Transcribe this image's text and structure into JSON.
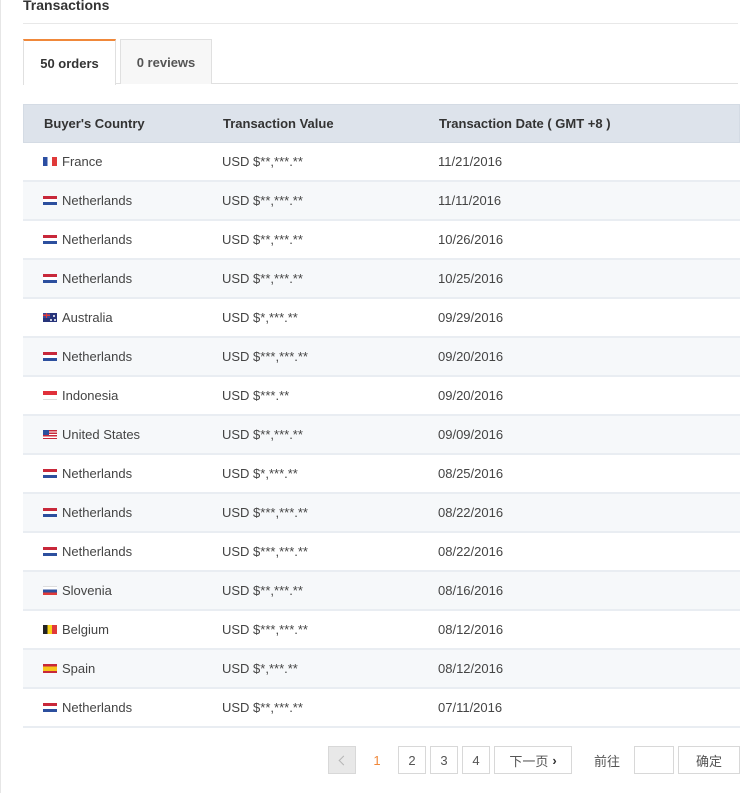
{
  "section": {
    "title": "Transactions"
  },
  "tabs": [
    {
      "label": "50 orders",
      "active": true
    },
    {
      "label": "0 reviews",
      "active": false
    }
  ],
  "table": {
    "headers": [
      "Buyer's Country",
      "Transaction Value",
      "Transaction Date ( GMT +8 )"
    ],
    "rows": [
      {
        "flag": "fr",
        "country": "France",
        "value": "USD $**,***.**",
        "date": "11/21/2016"
      },
      {
        "flag": "nl",
        "country": "Netherlands",
        "value": "USD $**,***.**",
        "date": "11/11/2016"
      },
      {
        "flag": "nl",
        "country": "Netherlands",
        "value": "USD $**,***.**",
        "date": "10/26/2016"
      },
      {
        "flag": "nl",
        "country": "Netherlands",
        "value": "USD $**,***.**",
        "date": "10/25/2016"
      },
      {
        "flag": "au",
        "country": "Australia",
        "value": "USD $*,***.**",
        "date": "09/29/2016"
      },
      {
        "flag": "nl",
        "country": "Netherlands",
        "value": "USD $***,***.**",
        "date": "09/20/2016"
      },
      {
        "flag": "id",
        "country": "Indonesia",
        "value": "USD $***.**",
        "date": "09/20/2016"
      },
      {
        "flag": "us",
        "country": "United States",
        "value": "USD $**,***.**",
        "date": "09/09/2016"
      },
      {
        "flag": "nl",
        "country": "Netherlands",
        "value": "USD $*,***.**",
        "date": "08/25/2016"
      },
      {
        "flag": "nl",
        "country": "Netherlands",
        "value": "USD $***,***.**",
        "date": "08/22/2016"
      },
      {
        "flag": "nl",
        "country": "Netherlands",
        "value": "USD $***,***.**",
        "date": "08/22/2016"
      },
      {
        "flag": "si",
        "country": "Slovenia",
        "value": "USD $**,***.**",
        "date": "08/16/2016"
      },
      {
        "flag": "be",
        "country": "Belgium",
        "value": "USD $***,***.**",
        "date": "08/12/2016"
      },
      {
        "flag": "es",
        "country": "Spain",
        "value": "USD $*,***.**",
        "date": "08/12/2016"
      },
      {
        "flag": "nl",
        "country": "Netherlands",
        "value": "USD $**,***.**",
        "date": "07/11/2016"
      }
    ]
  },
  "pagination": {
    "prev_icon": "chevron-left-icon",
    "pages": [
      "1",
      "2",
      "3",
      "4"
    ],
    "current_page": "1",
    "next_label": "下一页",
    "next_icon": "chevron-right-icon",
    "goto_label": "前往",
    "goto_value": "",
    "confirm_label": "确定"
  },
  "colors": {
    "accent": "#f0883a",
    "header_bg": "#dde3eb",
    "row_alt_bg": "#f6f8fa"
  }
}
